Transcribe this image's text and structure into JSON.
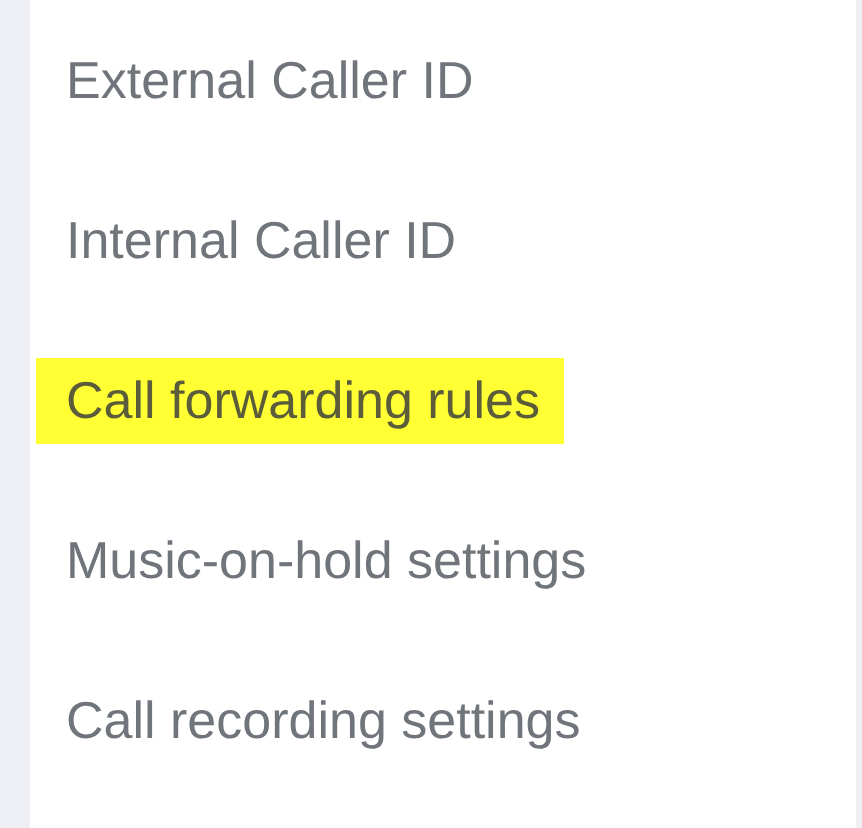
{
  "menu": {
    "items": [
      {
        "label": "External Caller ID",
        "highlighted": false
      },
      {
        "label": "Internal Caller ID",
        "highlighted": false
      },
      {
        "label": "Call forwarding rules",
        "highlighted": true
      },
      {
        "label": "Music-on-hold settings",
        "highlighted": false
      },
      {
        "label": "Call recording settings",
        "highlighted": false
      }
    ]
  }
}
